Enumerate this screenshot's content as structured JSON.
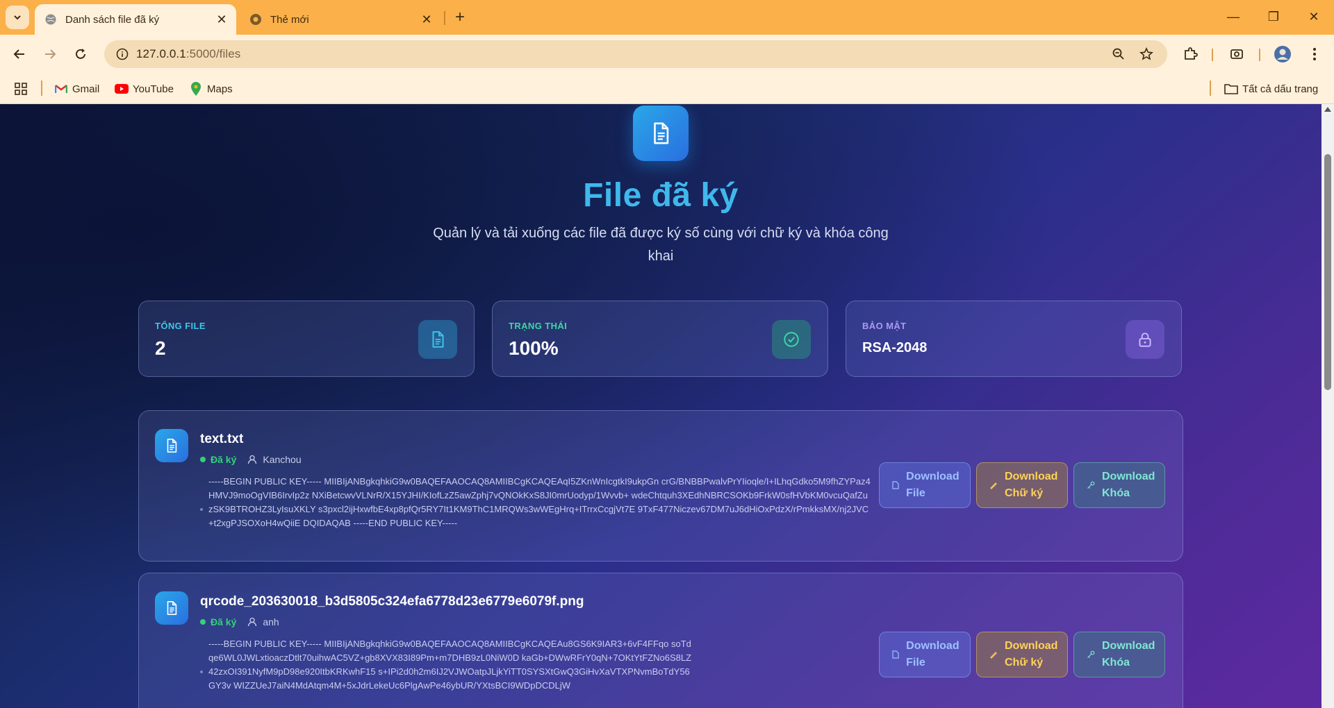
{
  "browser": {
    "tabs": [
      {
        "title": "Danh sách file đã ký",
        "active": true
      },
      {
        "title": "Thẻ mới",
        "active": false
      }
    ],
    "url_host": "127.0.0.1",
    "url_path": ":5000/files",
    "bookmarks": [
      "Gmail",
      "YouTube",
      "Maps"
    ],
    "all_bookmarks": "Tất cả dấu trang"
  },
  "page": {
    "title": "File đã ký",
    "subtitle": "Quản lý và tải xuống các file đã được ký số cùng với chữ ký và khóa công khai"
  },
  "stats": [
    {
      "label": "TỔNG FILE",
      "value": "2",
      "color": "#3fc6e6"
    },
    {
      "label": "TRẠNG THÁI",
      "value": "100%",
      "color": "#3fd6a8"
    },
    {
      "label": "BẢO MẬT",
      "value": "RSA-2048",
      "color": "#a99cf0"
    }
  ],
  "files": [
    {
      "name": "text.txt",
      "status": "Đã ký",
      "user": "Kanchou",
      "public_key": "-----BEGIN PUBLIC KEY----- MIIBIjANBgkqhkiG9w0BAQEFAAOCAQ8AMIIBCgKCAQEAqI5ZKnWnIcgtkI9ukpGn crG/BNBBPwalvPrYIioqle/I+ILhqGdko5M9fhZYPaz4HMVJ9moOgVIB6IrvIp2z NXiBetcwvVLNrR/X15YJHI/KIofLzZ5awZphj7vQNOkKxS8JI0mrUodyp/1Wvvb+ wdeChtquh3XEdhNBRCSOKb9FrkW0sfHVbKM0vcuQafZuzSK9BTROHZ3LyIsuXKLY s3pxcl2ijHxwfbE4xp8pfQr5RY7It1KM9ThC1MRQWs3wWEgHrq+ITrrxCcgjVt7E 9TxF477Niczev67DM7uJ6dHiOxPdzX/rPmkksMX/nj2JVC+t2xgPJSOXoH4wQiiE DQIDAQAB -----END PUBLIC KEY-----"
    },
    {
      "name": "qrcode_203630018_b3d5805c324efa6778d23e6779e6079f.png",
      "status": "Đã ký",
      "user": "anh",
      "public_key": "-----BEGIN PUBLIC KEY----- MIIBIjANBgkqhkiG9w0BAQEFAAOCAQ8AMIIBCgKCAQEAu8GS6K9IAR3+6vF4FFqo soTdqe6WL0JWLxtioaczDtlt70uihwAC5VZ+gb8XVX83I89Pm+m7DHB9zL0NiW0D kaGb+DWwRFrY0qN+7OKtYtFZNo6S8LZ42zxOI391NyfM9pD98e920ItbKRKwhF15 s+IPi2d0h2m6IJ2VJWOatpJLjkYiTT0SYSXtGwQ3GiHvXaVTXPNvmBoTdY56GY3v WIZZUeJ7aiN4MdAtqm4M+5xJdrLekeUc6PlgAwPe46ybUR/YXtsBCI9WDpDCDLjW"
    }
  ],
  "buttons": {
    "download_file": "Download File",
    "download_signature": "Download Chữ ký",
    "download_key": "Download Khóa"
  }
}
